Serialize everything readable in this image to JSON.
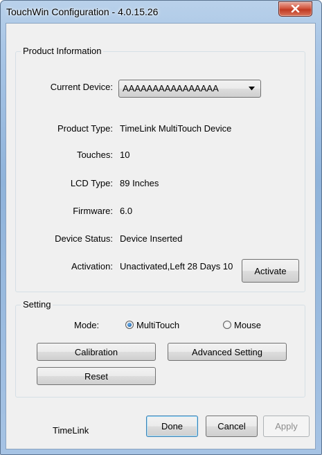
{
  "window": {
    "title": "TouchWin Configuration - 4.0.15.26"
  },
  "product_info": {
    "group_label": "Product Information",
    "current_device_label": "Current Device:",
    "current_device_value": "AAAAAAAAAAAAAAAA",
    "product_type_label": "Product Type:",
    "product_type_value": "TimeLink MultiTouch Device",
    "touches_label": "Touches:",
    "touches_value": "10",
    "lcd_type_label": "LCD Type:",
    "lcd_type_value": "89 Inches",
    "firmware_label": "Firmware:",
    "firmware_value": "6.0",
    "device_status_label": "Device Status:",
    "device_status_value": "Device Inserted",
    "activation_label": "Activation:",
    "activation_value": "Unactivated,Left 28 Days 10",
    "activate_button": "Activate"
  },
  "setting": {
    "group_label": "Setting",
    "mode_label": "Mode:",
    "mode_multitouch": "MultiTouch",
    "mode_mouse": "Mouse",
    "selected_mode": "MultiTouch",
    "calibration_button": "Calibration",
    "advanced_button": "Advanced Setting",
    "reset_button": "Reset"
  },
  "footer": {
    "brand": "TimeLink",
    "done_button": "Done",
    "cancel_button": "Cancel",
    "apply_button": "Apply"
  },
  "icons": {
    "close": "close-icon",
    "dropdown": "chevron-down-icon"
  }
}
